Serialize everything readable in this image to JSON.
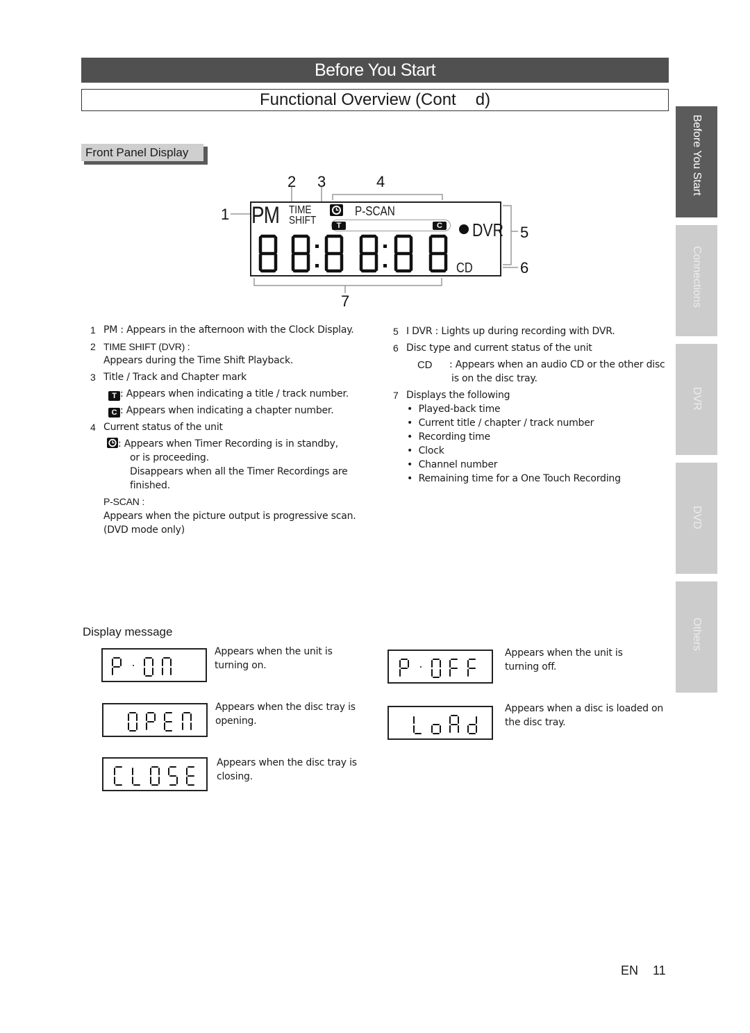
{
  "header": {
    "section": "Before You Start",
    "title_prefix": "Functional Overview (Cont",
    "title_suffix": "d)"
  },
  "subsection": {
    "label": "Front Panel Display"
  },
  "side_tabs": [
    {
      "label": "Before You Start",
      "active": true
    },
    {
      "label": "Connections",
      "active": false
    },
    {
      "label": "DVR",
      "active": false
    },
    {
      "label": "DVD",
      "active": false
    },
    {
      "label": "Others",
      "active": false
    }
  ],
  "lcd": {
    "callouts": [
      "1",
      "2",
      "3",
      "4",
      "5",
      "6",
      "7"
    ],
    "pm": "PM",
    "time": "TIME",
    "shift": "SHIFT",
    "pscan": "P-SCAN",
    "title_mark": "T",
    "chapter_mark": "C",
    "dvr": "DVR",
    "cd": "CD",
    "digits": "88:8 8:88"
  },
  "left_items": {
    "i1_num": "1",
    "i1_text": "PM : Appears in the afternoon with the Clock Display.",
    "i2_num": "2",
    "i2_title": "TIME SHIFT  (DVR) :",
    "i2_text": "Appears during the Time Shift Playback.",
    "i3_num": "3",
    "i3_title": "Title / Track and Chapter mark",
    "i3_t_icon": "T",
    "i3_t_text": ": Appears when indicating a title / track number.",
    "i3_c_icon": "C",
    "i3_c_text": ": Appears when indicating a chapter number.",
    "i4_num": "4",
    "i4_title": "Current status of the unit",
    "i4_timer_l1": ": Appears when Timer Recording is in standby,",
    "i4_timer_l2": "or is proceeding.",
    "i4_timer_l3": "Disappears when all the Timer Recordings are",
    "i4_timer_l4": "finished.",
    "i4_pscan_title": "P-SCAN  :",
    "i4_pscan_l1": "Appears when the picture output is progressive scan.",
    "i4_pscan_l2": "(DVD mode only)"
  },
  "right_items": {
    "i5_num": "5",
    "i5_text": "I  DVR  : Lights up during recording with DVR.",
    "i6_num": "6",
    "i6_title": "Disc type and current status of the unit",
    "i6_cd": "CD",
    "i6_l1": ": Appears when an audio CD or the other disc",
    "i6_l2": "is on the disc tray.",
    "i7_num": "7",
    "i7_title": "Displays the following",
    "i7_bullets": [
      "Played-back time",
      "Current title / chapter / track number",
      "Recording time",
      "Clock",
      "Channel number",
      "Remaining time for a One Touch Recording"
    ]
  },
  "display_message": {
    "heading": "Display message",
    "messages": [
      {
        "display": "P-ON",
        "line1": "Appears when the unit is",
        "line2": "turning on."
      },
      {
        "display": "OPEN",
        "line1": "Appears when the disc tray is",
        "line2": "opening."
      },
      {
        "display": "CLOSE",
        "line1": "Appears when the disc tray is",
        "line2": "closing."
      },
      {
        "display": "P-OFF",
        "line1": "Appears when the unit is",
        "line2": "turning off."
      },
      {
        "display": "LoAd",
        "line1": "Appears when a disc is loaded on",
        "line2": "the disc tray."
      }
    ]
  },
  "footer": {
    "lang": "EN",
    "page": "11"
  }
}
